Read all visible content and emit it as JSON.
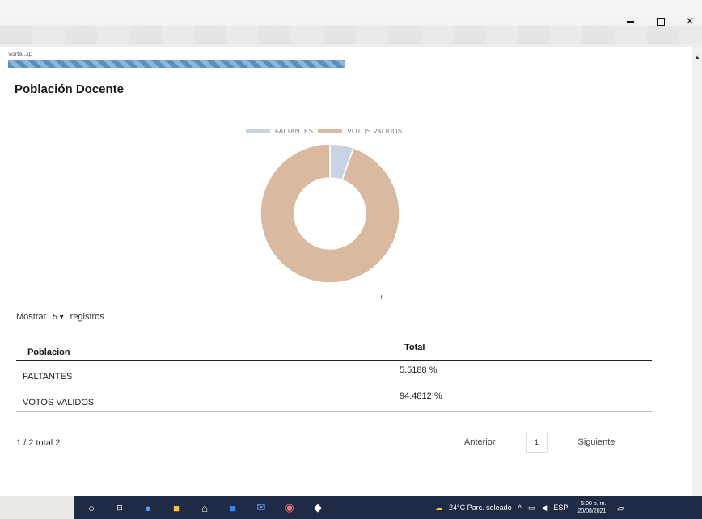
{
  "window": {
    "minimize_icon": "minimize-icon",
    "maximize_icon": "maximize-icon",
    "close_label": "×"
  },
  "page": {
    "portal_label": "vortal.xp",
    "loading_progress": 1.0,
    "title": "Población Docente"
  },
  "chart_data": {
    "type": "pie",
    "donut": true,
    "legend_position": "top",
    "categories": [
      "FALTANTES",
      "VOTOS VALIDOS"
    ],
    "values": [
      5.5188,
      94.4812
    ],
    "colors": [
      "#c8d3e3",
      "#d9b9a0"
    ]
  },
  "table_controls": {
    "show_prefix": "Mostrar",
    "show_value": "5",
    "show_suffix": "registros",
    "sort_icon": "I+"
  },
  "table": {
    "columns": [
      "Poblacion",
      "Total"
    ],
    "rows": [
      {
        "poblacion": "FALTANTES",
        "total": "5.5188 %"
      },
      {
        "poblacion": "VOTOS VALIDOS",
        "total": "94.4812 %"
      }
    ]
  },
  "pagination": {
    "info": "1 / 2 total 2",
    "prev_label": "Anterior",
    "current_page": "1",
    "next_label": "Siguiente"
  },
  "taskbar": {
    "weather": "24°C Parc. soleado",
    "language": "ESP",
    "time": "5:00 p. m.",
    "date": "20/08/2021",
    "icons": [
      "start-icon",
      "task-view-icon",
      "edge-icon",
      "file-explorer-icon",
      "store-icon",
      "app-icon",
      "mail-icon",
      "chrome-icon",
      "app2-icon"
    ]
  }
}
